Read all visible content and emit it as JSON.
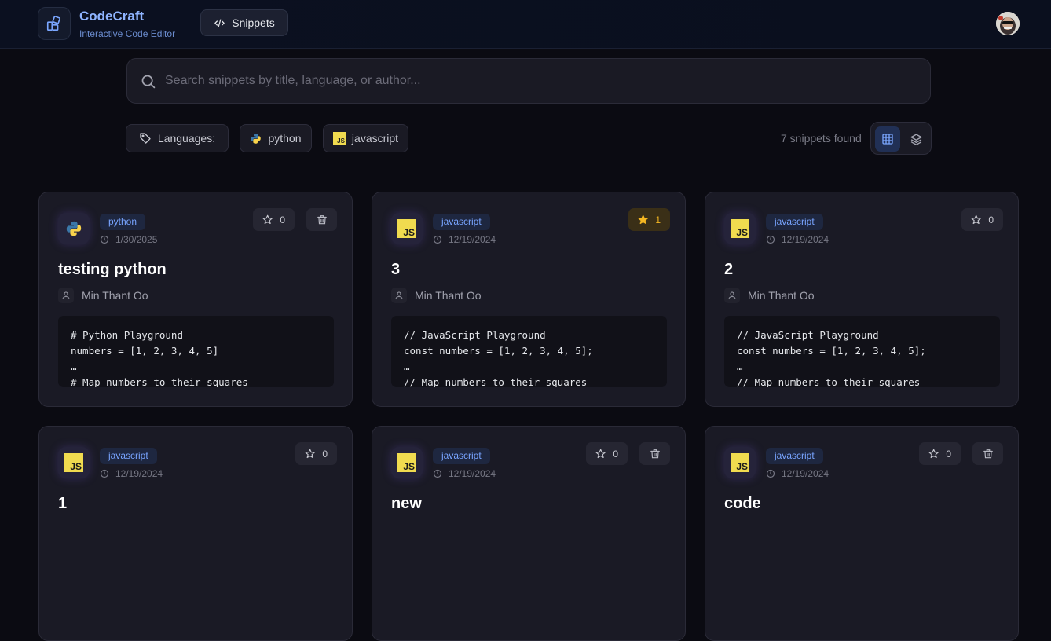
{
  "header": {
    "brand_title": "CodeCraft",
    "brand_subtitle": "Interactive Code Editor",
    "snippets_button": "Snippets"
  },
  "search": {
    "placeholder": "Search snippets by title, language, or author...",
    "value": ""
  },
  "filters": {
    "languages_label": "Languages:",
    "languages": [
      "python",
      "javascript"
    ]
  },
  "results": {
    "count_text": "7 snippets found"
  },
  "colors": {
    "accent": "#78a4ff",
    "brand": "#8fb4ff",
    "star_active": "#f5b722"
  },
  "cards": [
    {
      "language": "python",
      "date": "1/30/2025",
      "stars": "0",
      "starred": false,
      "deletable": true,
      "title": "testing python",
      "author": "Min Thant Oo",
      "code": "# Python Playground\nnumbers = [1, 2, 3, 4, 5]\n…\n# Map numbers to their squares"
    },
    {
      "language": "javascript",
      "date": "12/19/2024",
      "stars": "1",
      "starred": true,
      "deletable": false,
      "title": "3",
      "author": "Min Thant Oo",
      "code": "// JavaScript Playground\nconst numbers = [1, 2, 3, 4, 5];\n…\n// Map numbers to their squares"
    },
    {
      "language": "javascript",
      "date": "12/19/2024",
      "stars": "0",
      "starred": false,
      "deletable": false,
      "title": "2",
      "author": "Min Thant Oo",
      "code": "// JavaScript Playground\nconst numbers = [1, 2, 3, 4, 5];\n…\n// Map numbers to their squares"
    },
    {
      "language": "javascript",
      "date": "12/19/2024",
      "stars": "0",
      "starred": false,
      "deletable": false,
      "title": "1",
      "author": "",
      "code": ""
    },
    {
      "language": "javascript",
      "date": "12/19/2024",
      "stars": "0",
      "starred": false,
      "deletable": true,
      "title": "new",
      "author": "",
      "code": ""
    },
    {
      "language": "javascript",
      "date": "12/19/2024",
      "stars": "0",
      "starred": false,
      "deletable": true,
      "title": "code",
      "author": "",
      "code": ""
    }
  ]
}
